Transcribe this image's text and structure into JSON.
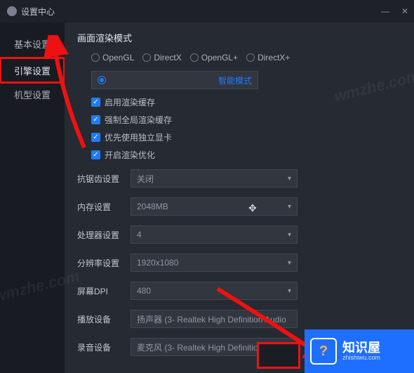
{
  "window": {
    "title": "设置中心",
    "min": "—",
    "close": "✕"
  },
  "sidebar": {
    "items": [
      {
        "label": "基本设置"
      },
      {
        "label": "引擎设置"
      },
      {
        "label": "机型设置"
      }
    ]
  },
  "render": {
    "title": "画面渲染模式",
    "modes": [
      {
        "label": "OpenGL"
      },
      {
        "label": "DirectX"
      },
      {
        "label": "OpenGL+"
      },
      {
        "label": "DirectX+"
      },
      {
        "label": "智能模式"
      }
    ],
    "checks": [
      {
        "label": "启用渲染缓存"
      },
      {
        "label": "强制全局渲染缓存"
      },
      {
        "label": "优先使用独立显卡"
      },
      {
        "label": "开启渲染优化"
      }
    ]
  },
  "rows": {
    "aa": {
      "label": "抗锯齿设置",
      "value": "关闭"
    },
    "mem": {
      "label": "内存设置",
      "value": "2048MB"
    },
    "cpu": {
      "label": "处理器设置",
      "value": "4"
    },
    "res": {
      "label": "分辨率设置",
      "value": "1920x1080"
    },
    "dpi": {
      "label": "屏幕DPI",
      "value": "480"
    },
    "playdev": {
      "label": "播放设备",
      "value": "扬声器 (3- Realtek High Definition Audio"
    },
    "recdev": {
      "label": "录音设备",
      "value": "麦克风 (3- Realtek High Definition Audio"
    }
  },
  "banner": {
    "cn": "知识屋",
    "en": "zhishiwu.com",
    "q": "?"
  },
  "watermark": "wmzhe.com"
}
